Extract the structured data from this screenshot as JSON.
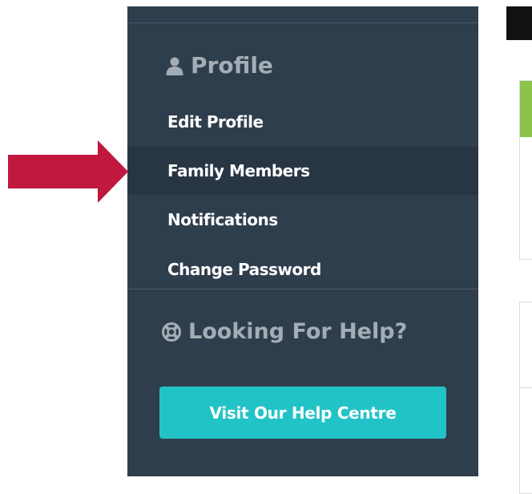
{
  "sidebar": {
    "profile_title": "Profile",
    "items": [
      {
        "label": "Edit Profile",
        "active": false
      },
      {
        "label": "Family Members",
        "active": true
      },
      {
        "label": "Notifications",
        "active": false
      },
      {
        "label": "Change Password",
        "active": false
      }
    ],
    "help_title": "Looking For Help?",
    "help_button_label": "Visit Our Help Centre"
  },
  "colors": {
    "sidebar_bg": "#2f3e4d",
    "active_bg": "#283644",
    "help_button": "#22c3c7",
    "arrow": "#c0183f",
    "card_header": "#8bc34a"
  },
  "icons": {
    "profile": "user-icon",
    "help": "life-ring-icon",
    "pointer": "arrow-right-icon"
  }
}
